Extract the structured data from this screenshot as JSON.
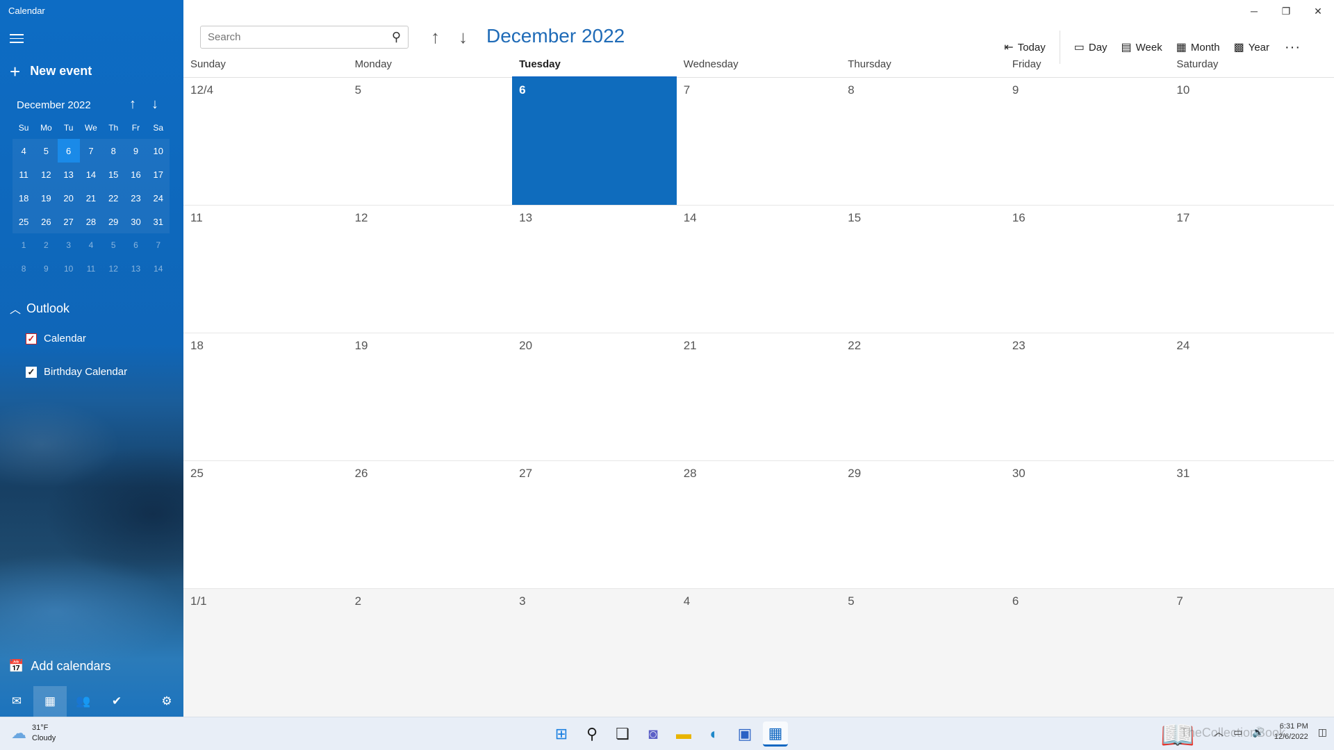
{
  "app": {
    "title": "Calendar"
  },
  "sidebar": {
    "new_event_label": "New event",
    "mini_calendar": {
      "month_label": "December 2022",
      "dow": [
        "Su",
        "Mo",
        "Tu",
        "We",
        "Th",
        "Fr",
        "Sa"
      ],
      "weeks": [
        [
          "4",
          "5",
          "6",
          "7",
          "8",
          "9",
          "10"
        ],
        [
          "11",
          "12",
          "13",
          "14",
          "15",
          "16",
          "17"
        ],
        [
          "18",
          "19",
          "20",
          "21",
          "22",
          "23",
          "24"
        ],
        [
          "25",
          "26",
          "27",
          "28",
          "29",
          "30",
          "31"
        ],
        [
          "1",
          "2",
          "3",
          "4",
          "5",
          "6",
          "7"
        ],
        [
          "8",
          "9",
          "10",
          "11",
          "12",
          "13",
          "14"
        ]
      ],
      "today": "6"
    },
    "account": {
      "label": "Outlook"
    },
    "calendars": [
      {
        "label": "Calendar",
        "color": "#d42121",
        "checked": true
      },
      {
        "label": "Birthday Calendar",
        "color": "#ffffff",
        "checked": true
      }
    ],
    "add_calendars_label": "Add calendars",
    "bottom_icons": [
      "mail-icon",
      "calendar-icon",
      "people-icon",
      "todo-icon",
      "settings-icon"
    ]
  },
  "toolbar": {
    "search_placeholder": "Search",
    "month_title": "December 2022",
    "views": [
      {
        "label": "Today",
        "icon": "today-icon"
      },
      {
        "label": "Day",
        "icon": "day-icon"
      },
      {
        "label": "Week",
        "icon": "week-icon"
      },
      {
        "label": "Month",
        "icon": "month-icon"
      },
      {
        "label": "Year",
        "icon": "year-icon"
      }
    ],
    "more_label": "···"
  },
  "month_view": {
    "days_of_week": [
      "Sunday",
      "Monday",
      "Tuesday",
      "Wednesday",
      "Thursday",
      "Friday",
      "Saturday"
    ],
    "selected_dow": "Tuesday",
    "weeks": [
      [
        "12/4",
        "5",
        "6",
        "7",
        "8",
        "9",
        "10"
      ],
      [
        "11",
        "12",
        "13",
        "14",
        "15",
        "16",
        "17"
      ],
      [
        "18",
        "19",
        "20",
        "21",
        "22",
        "23",
        "24"
      ],
      [
        "25",
        "26",
        "27",
        "28",
        "29",
        "30",
        "31"
      ],
      [
        "1/1",
        "2",
        "3",
        "4",
        "5",
        "6",
        "7"
      ]
    ],
    "today": "6",
    "accent_color": "#0f6cbd"
  },
  "taskbar": {
    "weather": {
      "temp": "31°F",
      "condition": "Cloudy"
    },
    "clock": {
      "time": "6:31 PM",
      "date": "12/6/2022"
    },
    "watermark": "TheCollectionBook"
  }
}
